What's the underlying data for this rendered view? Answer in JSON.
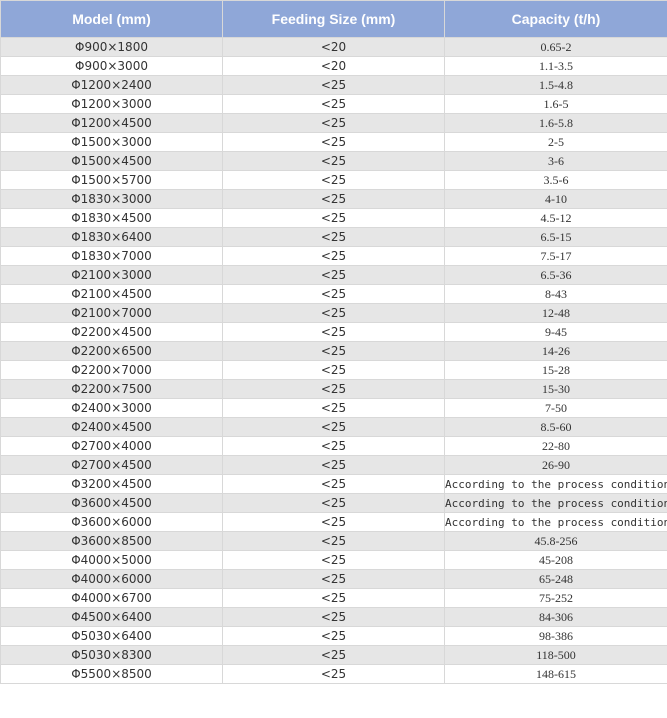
{
  "table": {
    "headers": [
      "Model (mm)",
      "Feeding Size (mm)",
      "Capacity (t/h)"
    ],
    "rows": [
      [
        "Φ900×1800",
        "<20",
        "0.65-2"
      ],
      [
        "Φ900×3000",
        "<20",
        "1.1-3.5"
      ],
      [
        "Φ1200×2400",
        "<25",
        "1.5-4.8"
      ],
      [
        "Φ1200×3000",
        "<25",
        "1.6-5"
      ],
      [
        "Φ1200×4500",
        "<25",
        "1.6-5.8"
      ],
      [
        "Φ1500×3000",
        "<25",
        "2-5"
      ],
      [
        "Φ1500×4500",
        "<25",
        "3-6"
      ],
      [
        "Φ1500×5700",
        "<25",
        "3.5-6"
      ],
      [
        "Φ1830×3000",
        "<25",
        "4-10"
      ],
      [
        "Φ1830×4500",
        "<25",
        "4.5-12"
      ],
      [
        "Φ1830×6400",
        "<25",
        "6.5-15"
      ],
      [
        "Φ1830×7000",
        "<25",
        "7.5-17"
      ],
      [
        "Φ2100×3000",
        "<25",
        "6.5-36"
      ],
      [
        "Φ2100×4500",
        "<25",
        "8-43"
      ],
      [
        "Φ2100×7000",
        "<25",
        "12-48"
      ],
      [
        "Φ2200×4500",
        "<25",
        "9-45"
      ],
      [
        "Φ2200×6500",
        "<25",
        "14-26"
      ],
      [
        "Φ2200×7000",
        "<25",
        "15-28"
      ],
      [
        "Φ2200×7500",
        "<25",
        "15-30"
      ],
      [
        "Φ2400×3000",
        "<25",
        "7-50"
      ],
      [
        "Φ2400×4500",
        "<25",
        "8.5-60"
      ],
      [
        "Φ2700×4000",
        "<25",
        "22-80"
      ],
      [
        "Φ2700×4500",
        "<25",
        "26-90"
      ],
      [
        "Φ3200×4500",
        "<25",
        "According to the process conditions"
      ],
      [
        "Φ3600×4500",
        "<25",
        "According to the process conditions"
      ],
      [
        "Φ3600×6000",
        "<25",
        "According to the process conditions"
      ],
      [
        "Φ3600×8500",
        "<25",
        "45.8-256"
      ],
      [
        "Φ4000×5000",
        "<25",
        "45-208"
      ],
      [
        "Φ4000×6000",
        "<25",
        "65-248"
      ],
      [
        "Φ4000×6700",
        "<25",
        "75-252"
      ],
      [
        "Φ4500×6400",
        "<25",
        "84-306"
      ],
      [
        "Φ5030×6400",
        "<25",
        "98-386"
      ],
      [
        "Φ5030×8300",
        "<25",
        "118-500"
      ],
      [
        "Φ5500×8500",
        "<25",
        "148-615"
      ]
    ]
  }
}
